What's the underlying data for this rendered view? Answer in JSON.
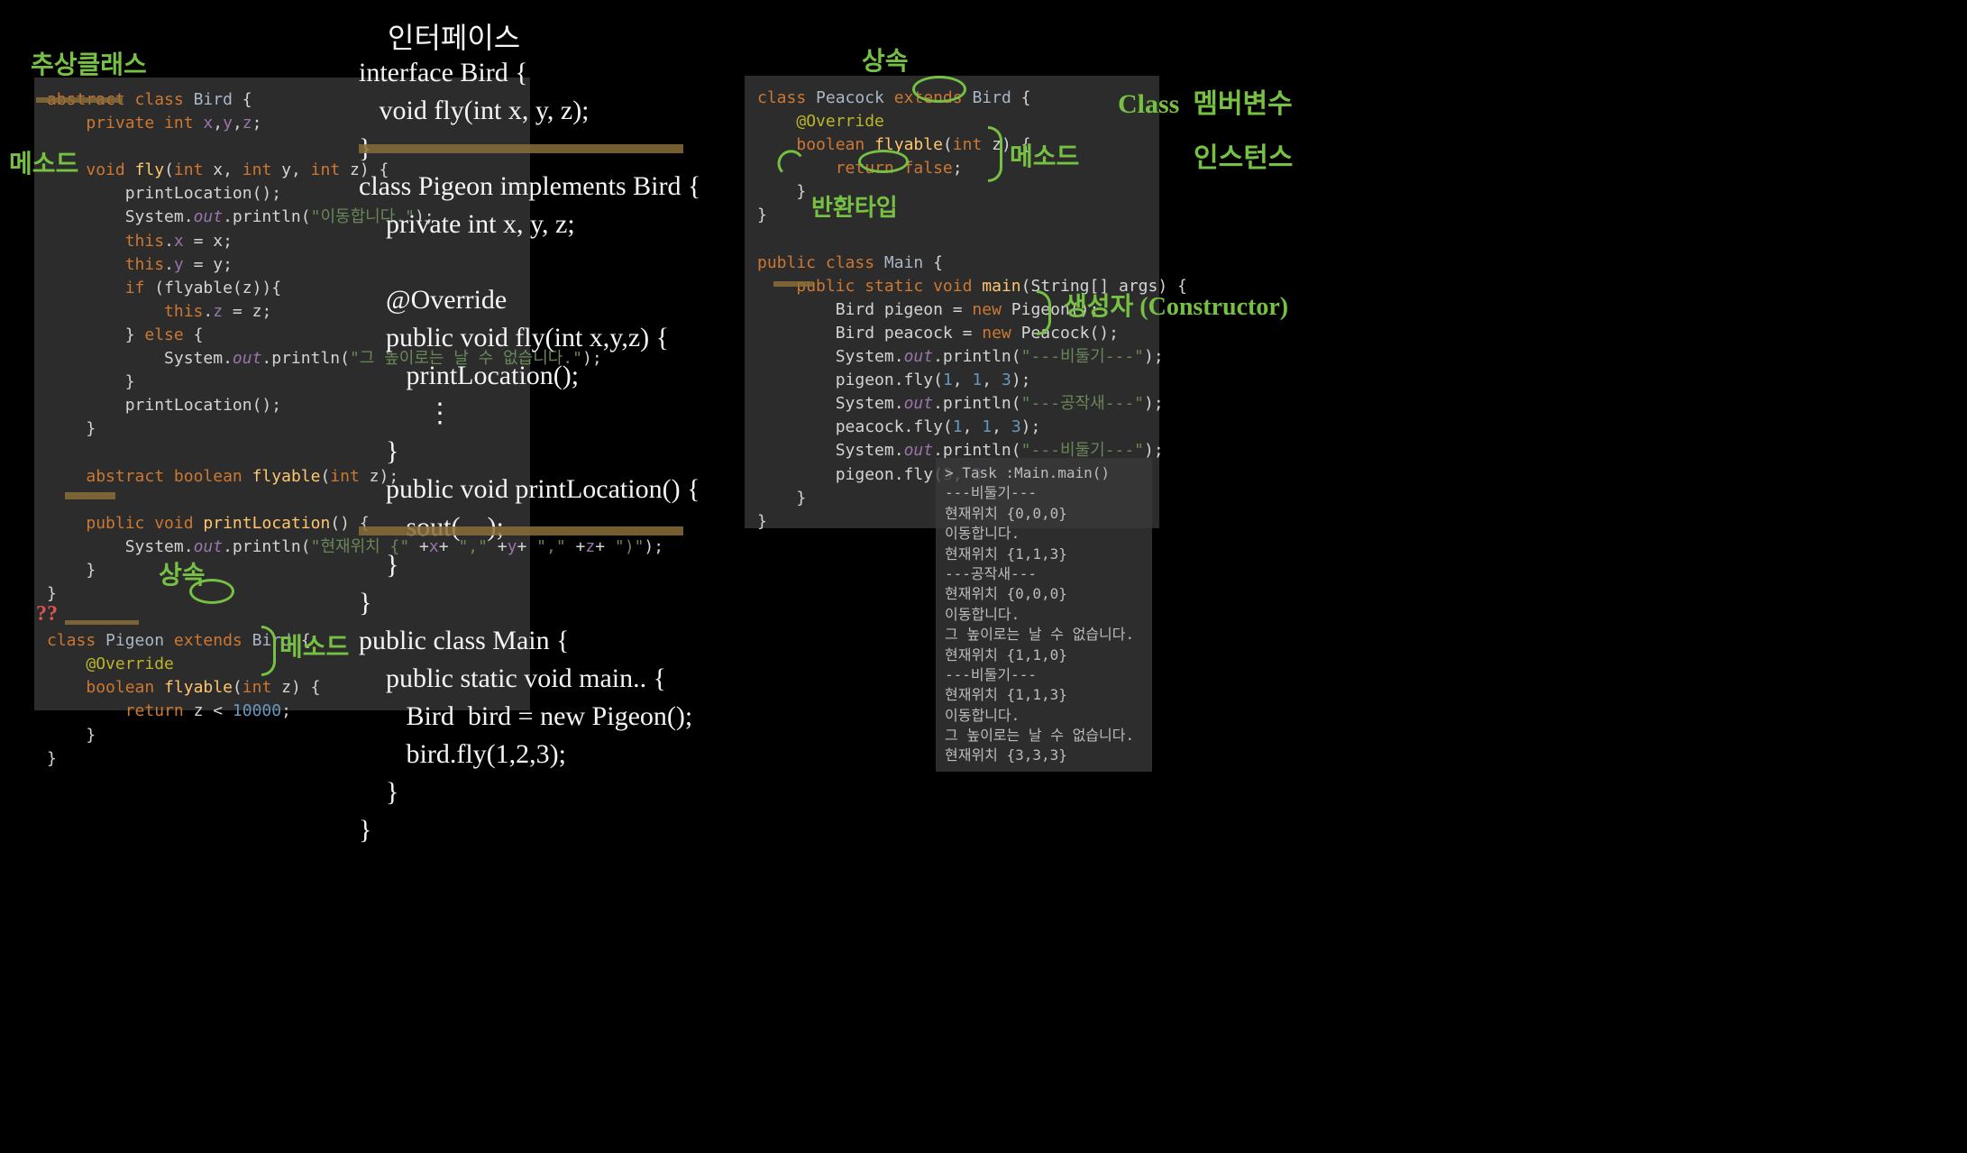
{
  "annotations": {
    "abstract_class": "추상클래스",
    "method_left": "메소드",
    "inherit_left": "상속",
    "method_left2": "메소드",
    "qmark": "??",
    "interface_title": "인터페이스",
    "inherit_right": "상속",
    "method_right": "메소드",
    "return_type": "반환타입",
    "class_member": "Class  멤버변수",
    "instance": "인스턴스",
    "constructor": "생성자 (Constructor)"
  },
  "code_left": "abstract class Bird {\n    private int x,y,z;\n\n    void fly(int x, int y, int z) {\n        printLocation();\n        System.out.println(\"이동합니다.\");\n        this.x = x;\n        this.y = y;\n        if (flyable(z)){\n            this.z = z;\n        } else {\n            System.out.println(\"그 높이로는 날 수 없습니다.\");\n        }\n        printLocation();\n    }\n\n    abstract boolean flyable(int z);\n\n    public void printLocation() {\n        System.out.println(\"현재위치 {\" +x+ \",\" +y+ \",\" +z+ \")\");\n    }\n}\n\nclass Pigeon extends Bird {\n    @Override\n    boolean flyable(int z) {\n        return z < 10000;\n    }\n}",
  "code_right": "class Peacock extends Bird {\n    @Override\n    boolean flyable(int z) {\n        return false;\n    }\n}\n\npublic class Main {\n    public static void main(String[] args) {\n        Bird pigeon = new Pigeon();\n        Bird peacock = new Peacock();\n        System.out.println(\"---비둘기---\");\n        pigeon.fly(1, 1, 3);\n        System.out.println(\"---공작새---\");\n        peacock.fly(1, 1, 3);\n        System.out.println(\"---비둘기---\");\n        pigeon.fly(3, 3\n    }\n}",
  "hand_interface": "interface Bird {\n   void fly(int x, y, z);\n}\nclass Pigeon implements Bird {\n    private int x, y, z;\n\n    @Override\n    public void fly(int x,y,z) {\n       printLocation();\n          ⋮\n    }\n    public void printLocation() {\n       sout(    );\n    }\n}\npublic class Main {\n    public static void main.. {\n       Bird  bird = new Pigeon();\n       bird.fly(1,2,3);\n    }\n}",
  "output": "> Task :Main.main()\n---비둘기---\n현재위치 {0,0,0}\n이동합니다.\n현재위치 {1,1,3}\n---공작새---\n현재위치 {0,0,0}\n이동합니다.\n그 높이로는 날 수 없습니다.\n현재위치 {1,1,0}\n---비둘기---\n현재위치 {1,1,3}\n이동합니다.\n그 높이로는 날 수 없습니다.\n현재위치 {3,3,3}"
}
